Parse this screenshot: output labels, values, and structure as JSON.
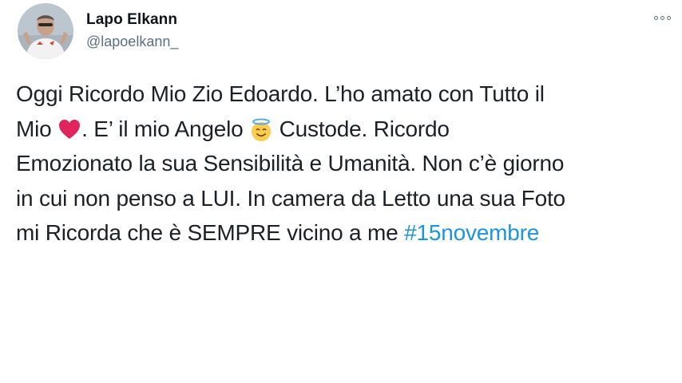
{
  "tweet": {
    "author": {
      "display_name": "Lapo Elkann",
      "handle": "@lapoelkann_",
      "avatar_icon": "user-avatar"
    },
    "more_icon": "more-options-icon",
    "text": {
      "line1": "Oggi Ricordo Mio Zio Edoardo. L’ho amato con Tutto il",
      "line2_a": "Mio ",
      "line2_emoji1": "red-heart-emoji",
      "line2_b": ". E’ il mio Angelo ",
      "line2_emoji2": "angel-halo-emoji",
      "line2_c": " Custode. Ricordo",
      "line3": "Emozionato la sua Sensibilità e Umanità. Non c’è giorno",
      "line4": "in cui non penso a LUI. In camera da Letto una sua Foto",
      "line5": "mi Ricorda che è SEMPRE vicino a me ",
      "hashtag": "#15novembre"
    },
    "colors": {
      "text": "#1b2126",
      "secondary": "#5b7083",
      "link": "#1b95e0",
      "heart": "#e0245e",
      "emoji_face": "#ffcc4d"
    }
  }
}
